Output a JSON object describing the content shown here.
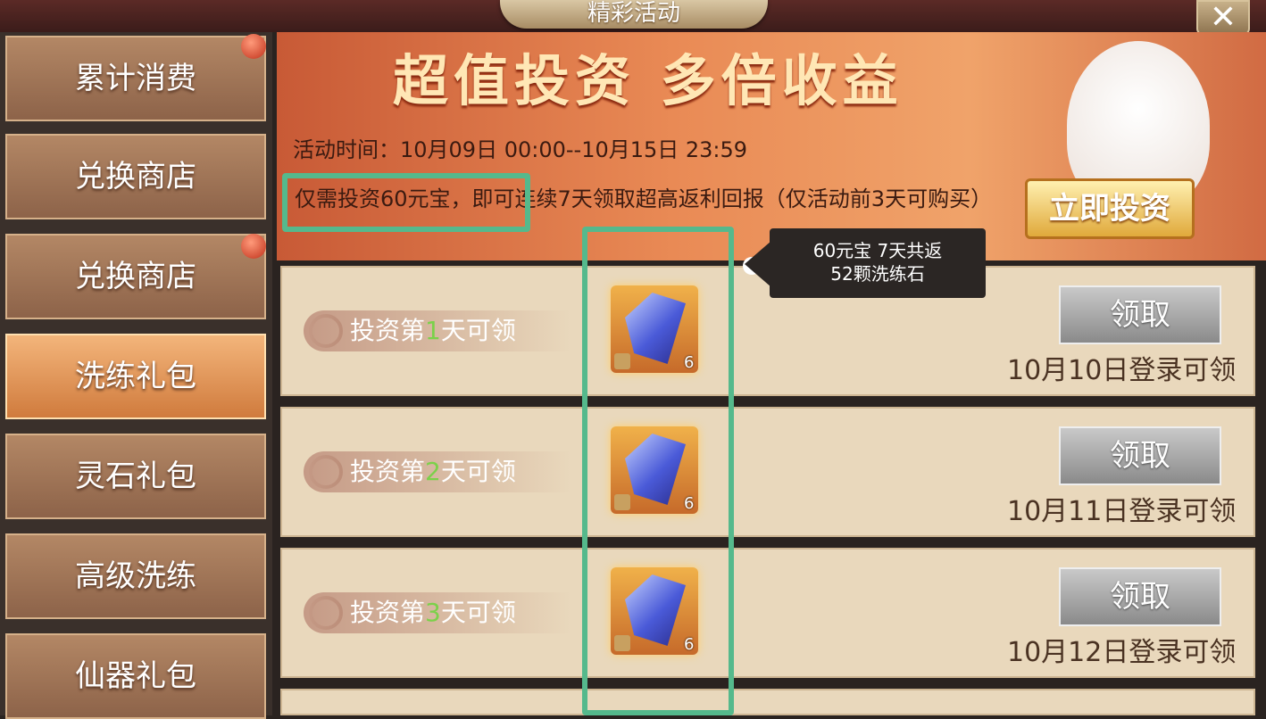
{
  "header": {
    "title": "精彩活动",
    "close_label": "✕"
  },
  "sidebar": {
    "items": [
      {
        "label": "累计消费",
        "active": false,
        "badge": true
      },
      {
        "label": "兑换商店",
        "active": false,
        "badge": false
      },
      {
        "label": "兑换商店",
        "active": false,
        "badge": true
      },
      {
        "label": "洗练礼包",
        "active": true,
        "badge": false
      },
      {
        "label": "灵石礼包",
        "active": false,
        "badge": false
      },
      {
        "label": "高级洗练",
        "active": false,
        "badge": false
      },
      {
        "label": "仙器礼包",
        "active": false,
        "badge": false
      }
    ]
  },
  "banner": {
    "title": "超值投资 多倍收益",
    "time": "活动时间：10月09日 00:00--10月15日 23:59",
    "desc": "仅需投资60元宝，即可连续7天领取超高返利回报（仅活动前3天可购买）",
    "invest_button": "立即投资"
  },
  "tooltip": {
    "line1": "60元宝  7天共返",
    "line2": "52颗洗练石"
  },
  "rows": [
    {
      "label_pre": "投资第",
      "day": "1",
      "label_post": "天可领",
      "count": "6",
      "claim": "领取",
      "date": "10月10日登录可领"
    },
    {
      "label_pre": "投资第",
      "day": "2",
      "label_post": "天可领",
      "count": "6",
      "claim": "领取",
      "date": "10月11日登录可领"
    },
    {
      "label_pre": "投资第",
      "day": "3",
      "label_post": "天可领",
      "count": "6",
      "claim": "领取",
      "date": "10月12日登录可领"
    }
  ],
  "colors": {
    "highlight": "#55b98c",
    "day_number": "#7bd14a"
  }
}
